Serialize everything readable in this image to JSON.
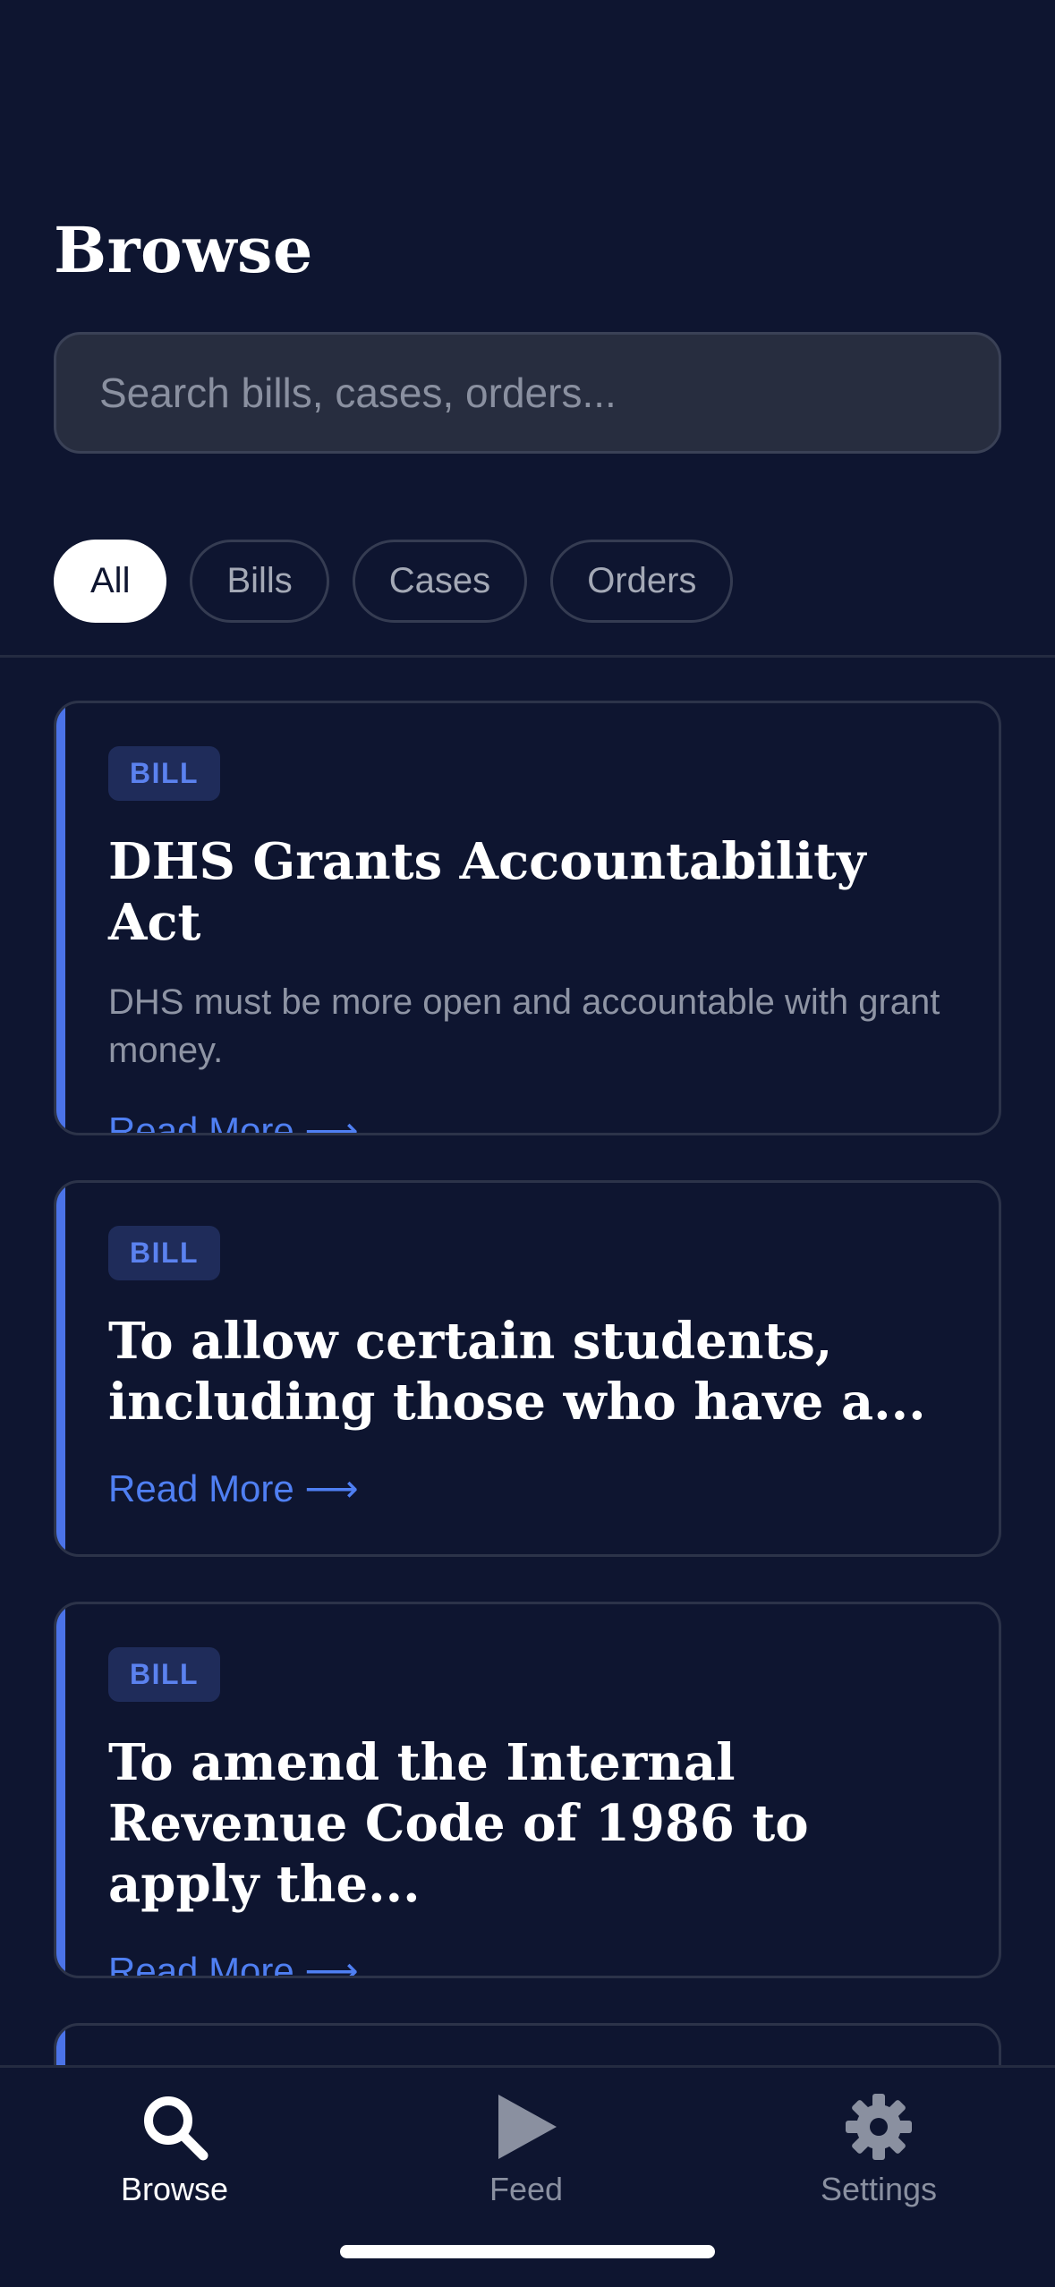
{
  "header": {
    "title": "Browse"
  },
  "search": {
    "placeholder": "Search bills, cases, orders..."
  },
  "filters": [
    {
      "label": "All",
      "active": true
    },
    {
      "label": "Bills",
      "active": false
    },
    {
      "label": "Cases",
      "active": false
    },
    {
      "label": "Orders",
      "active": false
    }
  ],
  "cards": [
    {
      "badge": "BILL",
      "title": "DHS Grants Accountability Act",
      "description": "DHS must be more open and accountable with grant money.",
      "read_more": "Read More ⟶"
    },
    {
      "badge": "BILL",
      "title": "To allow certain students, including those who have a...",
      "read_more": "Read More ⟶"
    },
    {
      "badge": "BILL",
      "title": "To amend the Internal Revenue Code of 1986 to apply the...",
      "read_more": "Read More ⟶"
    }
  ],
  "tabbar": {
    "browse": {
      "label": "Browse",
      "icon": "search-icon"
    },
    "feed": {
      "label": "Feed",
      "icon": "play-icon"
    },
    "settings": {
      "label": "Settings",
      "icon": "gear-icon"
    }
  },
  "colors": {
    "background": "#0e1530",
    "accent": "#4b73e8",
    "badge_bg": "#1f2c5a",
    "muted_text": "#8e94a4"
  }
}
